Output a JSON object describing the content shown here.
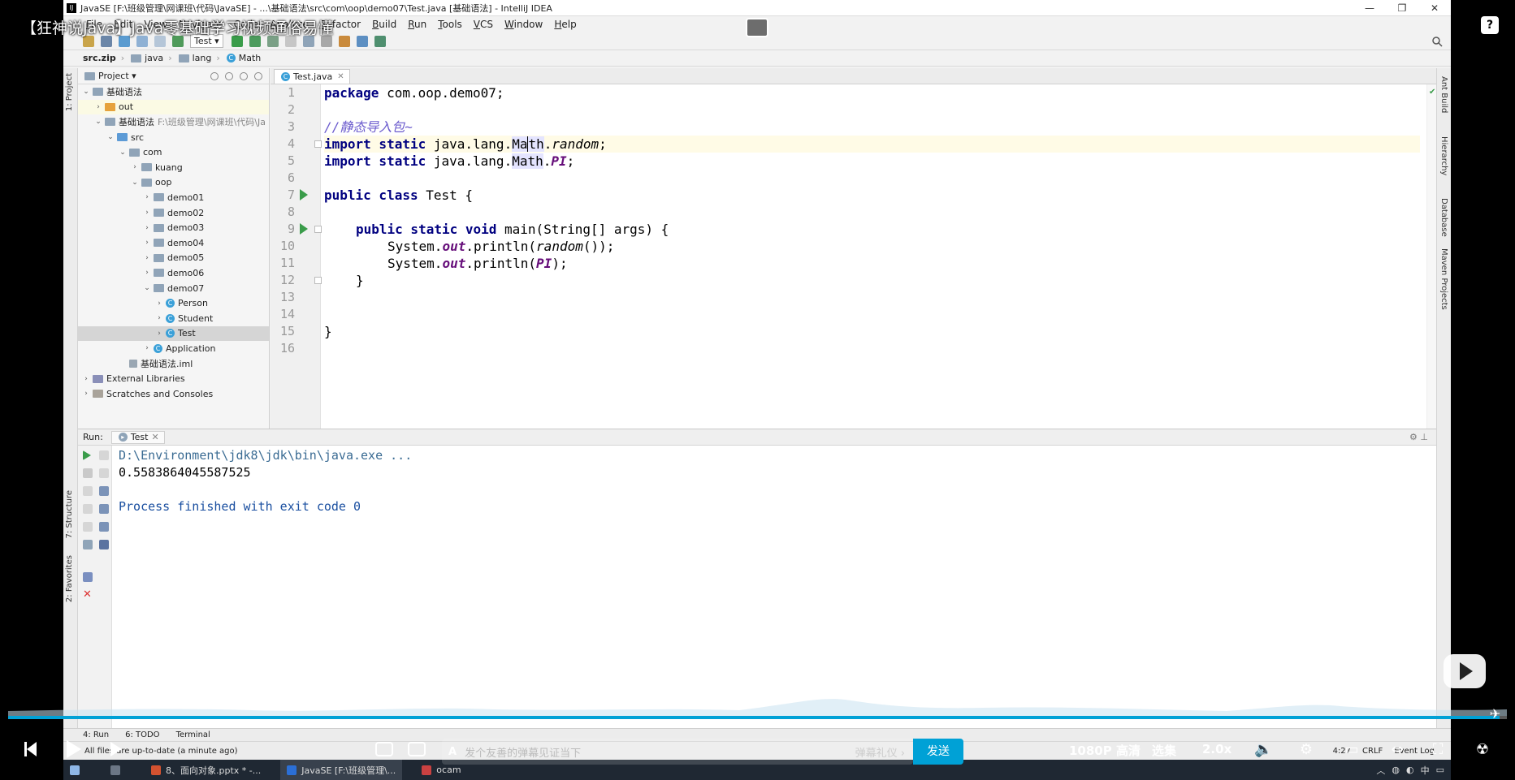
{
  "video": {
    "title": "【狂神说Java】Java零基础学习视频通俗易懂",
    "time": "4:27",
    "danmaku_placeholder": "发个友善的弹幕见证当下",
    "danmaku_etiquette": "弹幕礼仪 ›",
    "send_label": "发送",
    "quality": "1080P 高清",
    "episodes": "选集",
    "speed": "2.0x",
    "progress_fraction": 0.995,
    "accent": "#00a1d6"
  },
  "ide": {
    "window_title": "JavaSE [F:\\班级管理\\网课班\\代码\\JavaSE] - ...\\基础语法\\src\\com\\oop\\demo07\\Test.java [基础语法] - IntelliJ IDEA",
    "menu": [
      "File",
      "Edit",
      "View",
      "Navigate",
      "Code",
      "Analyze",
      "Refactor",
      "Build",
      "Run",
      "Tools",
      "VCS",
      "Window",
      "Help"
    ],
    "run_config": "Test ▾",
    "breadcrumb": [
      "src.zip",
      "java",
      "lang",
      "Math"
    ],
    "project": {
      "label": "Project ▾",
      "tree": [
        {
          "depth": 0,
          "label": "基础语法",
          "icon": "folder",
          "expanded": true
        },
        {
          "depth": 1,
          "label": "out",
          "icon": "folder-orange",
          "expanded": false
        },
        {
          "depth": 1,
          "label": "基础语法",
          "path": "F:\\班级管理\\网课班\\代码\\Ja",
          "icon": "folder",
          "expanded": true
        },
        {
          "depth": 2,
          "label": "src",
          "icon": "folder-blue",
          "expanded": true
        },
        {
          "depth": 3,
          "label": "com",
          "icon": "folder",
          "expanded": true
        },
        {
          "depth": 4,
          "label": "kuang",
          "icon": "folder",
          "expanded": false
        },
        {
          "depth": 4,
          "label": "oop",
          "icon": "folder",
          "expanded": true
        },
        {
          "depth": 5,
          "label": "demo01",
          "icon": "folder",
          "expanded": false
        },
        {
          "depth": 5,
          "label": "demo02",
          "icon": "folder",
          "expanded": false
        },
        {
          "depth": 5,
          "label": "demo03",
          "icon": "folder",
          "expanded": false
        },
        {
          "depth": 5,
          "label": "demo04",
          "icon": "folder",
          "expanded": false
        },
        {
          "depth": 5,
          "label": "demo05",
          "icon": "folder",
          "expanded": false
        },
        {
          "depth": 5,
          "label": "demo06",
          "icon": "folder",
          "expanded": false
        },
        {
          "depth": 5,
          "label": "demo07",
          "icon": "folder",
          "expanded": true
        },
        {
          "depth": 6,
          "label": "Person",
          "icon": "class",
          "expanded": false
        },
        {
          "depth": 6,
          "label": "Student",
          "icon": "class",
          "expanded": false
        },
        {
          "depth": 6,
          "label": "Test",
          "icon": "class",
          "expanded": false,
          "selected": true
        },
        {
          "depth": 5,
          "label": "Application",
          "icon": "class",
          "expanded": false
        },
        {
          "depth": 3,
          "label": "基础语法.iml",
          "icon": "file",
          "leaf": true
        },
        {
          "depth": 0,
          "label": "External Libraries",
          "icon": "lib",
          "expanded": false
        },
        {
          "depth": 0,
          "label": "Scratches and Consoles",
          "icon": "scratch",
          "expanded": false
        }
      ]
    },
    "editor_tab": "Test.java",
    "line_numbers": [
      "1",
      "2",
      "3",
      "4",
      "5",
      "6",
      "7",
      "8",
      "9",
      "10",
      "11",
      "12",
      "13",
      "14",
      "15",
      "16"
    ],
    "code": {
      "l1_kw": "package",
      "l1_rest": " com.oop.demo07;",
      "l3_comment": "//静态导入包~",
      "l4_kw": "import static",
      "l4_pre": " java.lang.",
      "l4_math_a": "Ma",
      "l4_math_b": "th",
      "l4_dot": ".",
      "l4_member": "random",
      "l4_end": ";",
      "l5_kw": "import static",
      "l5_pre": " java.lang.",
      "l5_math": "Math",
      "l5_dot": ".",
      "l5_member": "PI",
      "l5_end": ";",
      "l7_kw": "public class",
      "l7_rest": " Test {",
      "l9_kw": "public static void",
      "l9_rest": " main(String[] args) {",
      "l10_pre": "System.",
      "l10_out": "out",
      "l10_mid": ".println(",
      "l10_arg": "random",
      "l10_end": "());",
      "l11_pre": "System.",
      "l11_out": "out",
      "l11_mid": ".println(",
      "l11_arg": "PI",
      "l11_end": ");",
      "l12": "}",
      "l15": "}"
    },
    "run": {
      "label": "Run:",
      "tab": "Test",
      "console": [
        "D:\\Environment\\jdk8\\jdk\\bin\\java.exe ...",
        "0.5583864045587525",
        "",
        "Process finished with exit code 0"
      ]
    },
    "left_stripe": [
      "1: Project",
      "7: Structure",
      "2: Favorites"
    ],
    "right_stripe": [
      "Ant Build",
      "Hierarchy",
      "Database",
      "Maven Projects"
    ],
    "bottom_tabs": [
      "4: Run",
      "6: TODO",
      "Terminal"
    ],
    "status": "All files are up-to-date (a minute ago)",
    "status_right": [
      "4:27",
      "CRLF",
      "Event Log"
    ]
  },
  "taskbar": {
    "items": [
      "8、面向对象.pptx * -...",
      "JavaSE [F:\\班级管理\\...",
      "ocam"
    ]
  }
}
